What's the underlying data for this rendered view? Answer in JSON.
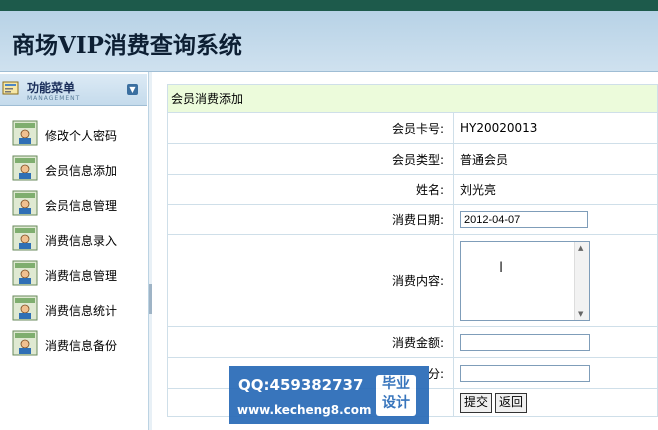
{
  "window": {
    "titlebar_text": "...VIP..."
  },
  "header": {
    "title": "商场VIP消费查询系统"
  },
  "sidebar": {
    "title": "功能菜单",
    "subtitle": "MANAGEMENT",
    "items": [
      {
        "label": "修改个人密码"
      },
      {
        "label": "会员信息添加"
      },
      {
        "label": "会员信息管理"
      },
      {
        "label": "消费信息录入"
      },
      {
        "label": "消费信息管理"
      },
      {
        "label": "消费信息统计"
      },
      {
        "label": "消费信息备份"
      }
    ]
  },
  "form": {
    "caption": "会员消费添加",
    "card_label": "会员卡号:",
    "card_value": "HY20020013",
    "type_label": "会员类型:",
    "type_value": "普通会员",
    "name_label": "姓名:",
    "name_value": "刘光亮",
    "date_label": "消费日期:",
    "date_value": "2012-04-07",
    "content_label": "消费内容:",
    "content_value": "",
    "amount_label": "消费金额:",
    "amount_value": "",
    "points_label_partial": "分:",
    "points_value": "",
    "submit_label": "提交",
    "back_label": "返回"
  },
  "watermark": {
    "qq": "QQ:459382737",
    "site": "www.kecheng8.com",
    "badge_line1": "毕业",
    "badge_line2": "设计"
  },
  "colors": {
    "header_bg": "#c3d9ea",
    "caption_bg": "#ecfbdb",
    "watermark_bg": "#2a6bb8"
  }
}
